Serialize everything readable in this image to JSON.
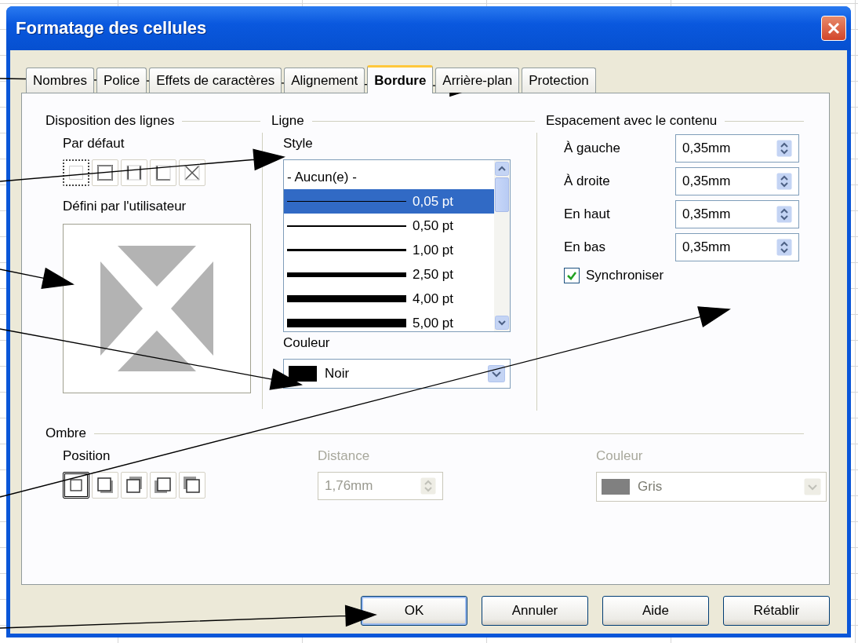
{
  "window": {
    "title": "Formatage des cellules"
  },
  "tabs": [
    {
      "label": "Nombres",
      "selected": false
    },
    {
      "label": "Police",
      "selected": false
    },
    {
      "label": "Effets de caractères",
      "selected": false
    },
    {
      "label": "Alignement",
      "selected": false
    },
    {
      "label": "Bordure",
      "selected": true
    },
    {
      "label": "Arrière-plan",
      "selected": false
    },
    {
      "label": "Protection",
      "selected": false
    }
  ],
  "line_arrangement": {
    "title": "Disposition des lignes",
    "default_label": "Par défaut",
    "presets": [
      {
        "kind": "none",
        "selected": true
      },
      {
        "kind": "outer",
        "selected": false
      },
      {
        "kind": "left-right",
        "selected": false
      },
      {
        "kind": "left-bottom",
        "selected": false
      },
      {
        "kind": "diagonal",
        "selected": false
      }
    ],
    "user_label": "Défini par l'utilisateur"
  },
  "line": {
    "title": "Ligne",
    "style_label": "Style",
    "styles": [
      {
        "label": "- Aucun(e) -",
        "kind": "none",
        "selected": false
      },
      {
        "label": "0,05 pt",
        "kind": "hairline",
        "selected": true
      },
      {
        "label": "0,50 pt",
        "kind": "thin",
        "selected": false
      },
      {
        "label": "1,00 pt",
        "kind": "medium",
        "selected": false
      },
      {
        "label": "2,50 pt",
        "kind": "thick",
        "selected": false
      },
      {
        "label": "4,00 pt",
        "kind": "heavy",
        "selected": false
      },
      {
        "label": "5,00 pt",
        "kind": "heavier",
        "selected": false
      }
    ],
    "color_label": "Couleur",
    "color_name": "Noir",
    "color": "#000000"
  },
  "spacing": {
    "title": "Espacement avec le contenu",
    "fields": [
      {
        "label": "À gauche",
        "value": "0,35mm"
      },
      {
        "label": "À droite",
        "value": "0,35mm"
      },
      {
        "label": "En haut",
        "value": "0,35mm"
      },
      {
        "label": "En bas",
        "value": "0,35mm"
      }
    ],
    "sync": {
      "label": "Synchroniser",
      "checked": true
    }
  },
  "shadow": {
    "title": "Ombre",
    "position_label": "Position",
    "positions": [
      {
        "kind": "none",
        "selected": true
      },
      {
        "kind": "bottom-right",
        "selected": false
      },
      {
        "kind": "top-right",
        "selected": false
      },
      {
        "kind": "bottom-left",
        "selected": false
      },
      {
        "kind": "top-left",
        "selected": false
      }
    ],
    "distance": {
      "label": "Distance",
      "value": "1,76mm",
      "disabled": true
    },
    "color": {
      "label": "Couleur",
      "name": "Gris",
      "color": "#808080",
      "disabled": true
    }
  },
  "buttons": [
    {
      "label": "OK",
      "default": true
    },
    {
      "label": "Annuler",
      "default": false
    },
    {
      "label": "Aide",
      "default": false
    },
    {
      "label": "Rétablir",
      "default": false
    }
  ]
}
